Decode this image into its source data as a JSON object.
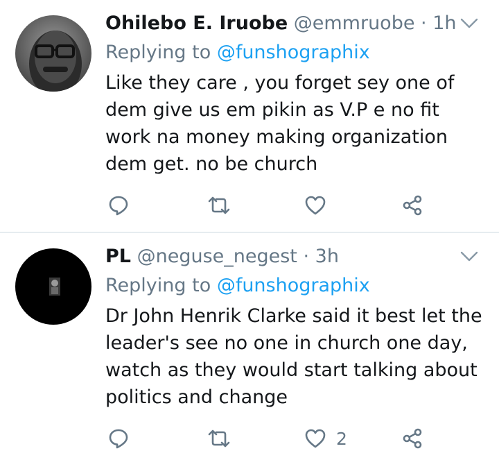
{
  "tweets": [
    {
      "name": "Ohilebo E. Iruobe",
      "handle": "@emmruobe",
      "separator": "·",
      "time": "1h",
      "replying_prefix": "Replying to",
      "replying_to": "@funshographix",
      "text": "Like they care , you forget sey one of dem give us em pikin as V.P e no fit work na money making organization dem get. no be church",
      "like_count": ""
    },
    {
      "name": "PL",
      "handle": "@neguse_negest",
      "separator": "·",
      "time": "3h",
      "replying_prefix": "Replying to",
      "replying_to": "@funshographix",
      "text": "Dr John Henrik Clarke said it best let the leader's see no one in church one day, watch as they would start talking about politics and change",
      "like_count": "2"
    }
  ],
  "colors": {
    "link": "#1da1f2",
    "muted": "#657786",
    "text": "#14171a",
    "divider": "#e6ecf0"
  }
}
